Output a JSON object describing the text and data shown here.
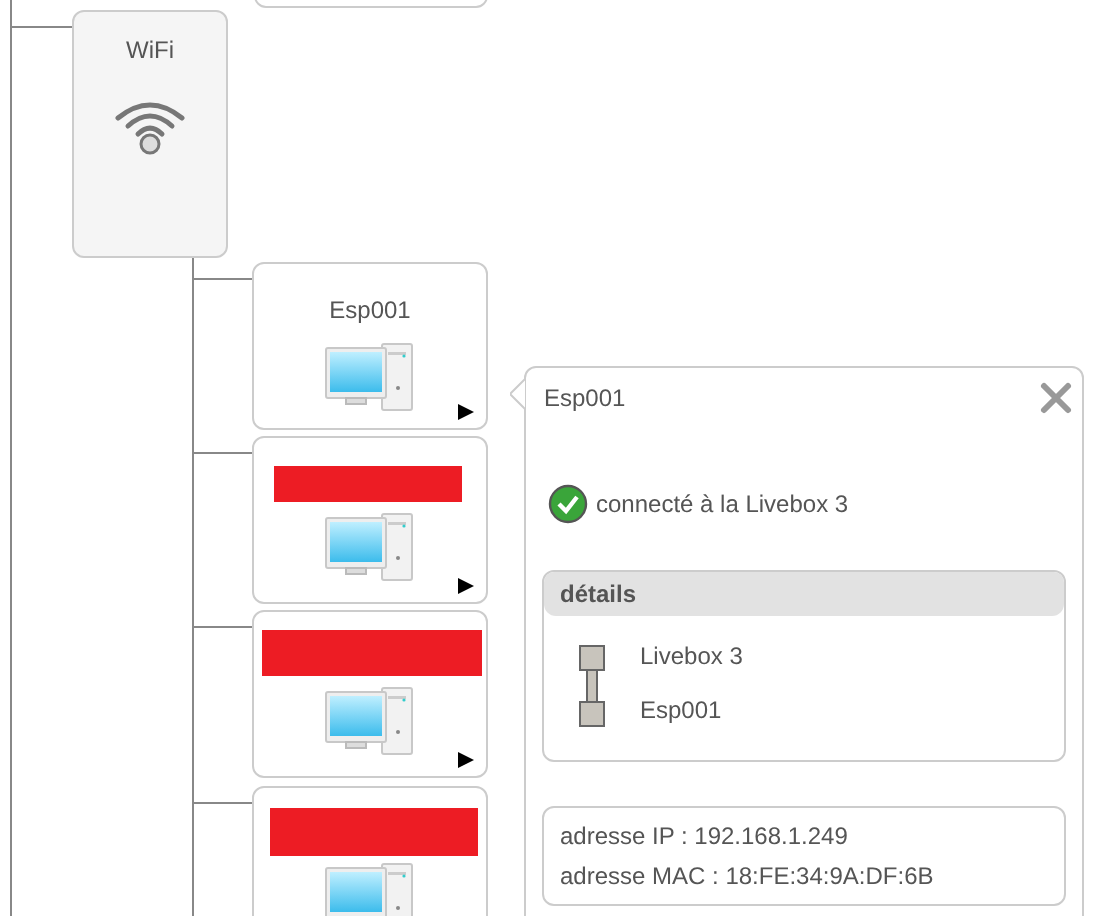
{
  "wifi_node": {
    "label": "WiFi"
  },
  "devices": [
    {
      "name": "Esp001",
      "redacted": false,
      "menu_arrow": true
    },
    {
      "redacted": true,
      "menu_arrow": true
    },
    {
      "redacted": true,
      "menu_arrow": true
    },
    {
      "redacted": true,
      "menu_arrow": false
    }
  ],
  "popup": {
    "title": "Esp001",
    "status": "connecté à la Livebox 3",
    "details": {
      "header": "détails",
      "path": [
        "Livebox 3",
        "Esp001"
      ]
    },
    "info": [
      "adresse IP : 192.168.1.249",
      "adresse MAC : 18:FE:34:9A:DF:6B"
    ]
  }
}
